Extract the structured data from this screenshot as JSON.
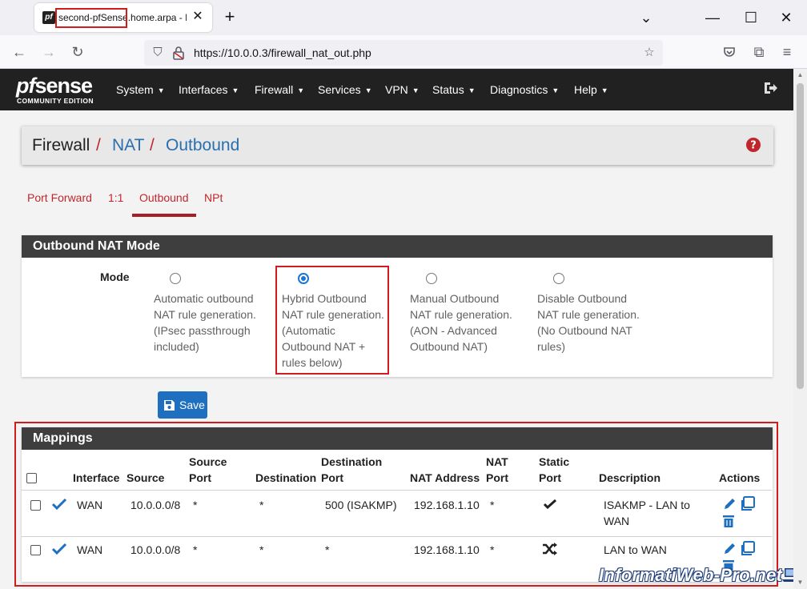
{
  "browser": {
    "tab_title": "second-pfSense.home.arpa - Fi",
    "favicon_text": "pf",
    "url": "https://10.0.0.3/firewall_nat_out.php",
    "icons": [
      "back-icon",
      "forward-icon",
      "reload-icon",
      "shield-icon",
      "lock-icon",
      "star-icon",
      "pocket-icon",
      "extensions-icon",
      "menu-icon"
    ]
  },
  "pfsense": {
    "logo_pf": "pf",
    "logo_sense": "sense",
    "logo_edition": "COMMUNITY EDITION",
    "menu": [
      "System",
      "Interfaces",
      "Firewall",
      "Services",
      "VPN",
      "Status",
      "Diagnostics",
      "Help"
    ]
  },
  "breadcrumb": {
    "root": "Firewall",
    "sep": "/",
    "level1": "NAT",
    "level2": "Outbound"
  },
  "subtabs": [
    "Port Forward",
    "1:1",
    "Outbound",
    "NPt"
  ],
  "active_subtab": "Outbound",
  "outbound_mode": {
    "heading": "Outbound NAT Mode",
    "label": "Mode",
    "options": [
      {
        "lines": [
          "Automatic outbound",
          "NAT rule generation.",
          "(IPsec passthrough",
          "included)"
        ],
        "checked": false
      },
      {
        "lines": [
          "Hybrid Outbound",
          "NAT rule generation.",
          "(Automatic",
          "Outbound NAT +",
          "rules below)"
        ],
        "checked": true
      },
      {
        "lines": [
          "Manual Outbound",
          "NAT rule generation.",
          "(AON - Advanced",
          "Outbound NAT)"
        ],
        "checked": false
      },
      {
        "lines": [
          "Disable Outbound",
          "NAT rule generation.",
          "(No Outbound NAT",
          "rules)"
        ],
        "checked": false
      }
    ],
    "save_label": "Save"
  },
  "mappings": {
    "heading": "Mappings",
    "columns": {
      "interface": "Interface",
      "source": "Source",
      "source_port": [
        "Source",
        "Port"
      ],
      "destination": "Destination",
      "destination_port": [
        "Destination",
        "Port"
      ],
      "nat_address": "NAT Address",
      "nat_port": [
        "NAT",
        "Port"
      ],
      "static_port": [
        "Static",
        "Port"
      ],
      "description": "Description",
      "actions": "Actions"
    },
    "rows": [
      {
        "interface": "WAN",
        "source": "10.0.0.0/8",
        "source_port": "*",
        "destination": "*",
        "destination_port": "500 (ISAKMP)",
        "nat_address": "192.168.1.10",
        "nat_port": "*",
        "static_port_icon": "check-icon",
        "description": [
          "ISAKMP - LAN to",
          "WAN"
        ]
      },
      {
        "interface": "WAN",
        "source": "10.0.0.0/8",
        "source_port": "*",
        "destination": "*",
        "destination_port": "*",
        "nat_address": "192.168.1.10",
        "nat_port": "*",
        "static_port_icon": "shuffle-icon",
        "description": [
          "LAN to WAN"
        ]
      }
    ]
  },
  "watermark": "InformatiWeb-Pro.net",
  "colors": {
    "accent_red": "#c0272d",
    "link_blue": "#2a6fad",
    "header_dark": "#212121",
    "save_blue": "#1e6fbf",
    "highlight_red": "#d21b1b"
  }
}
